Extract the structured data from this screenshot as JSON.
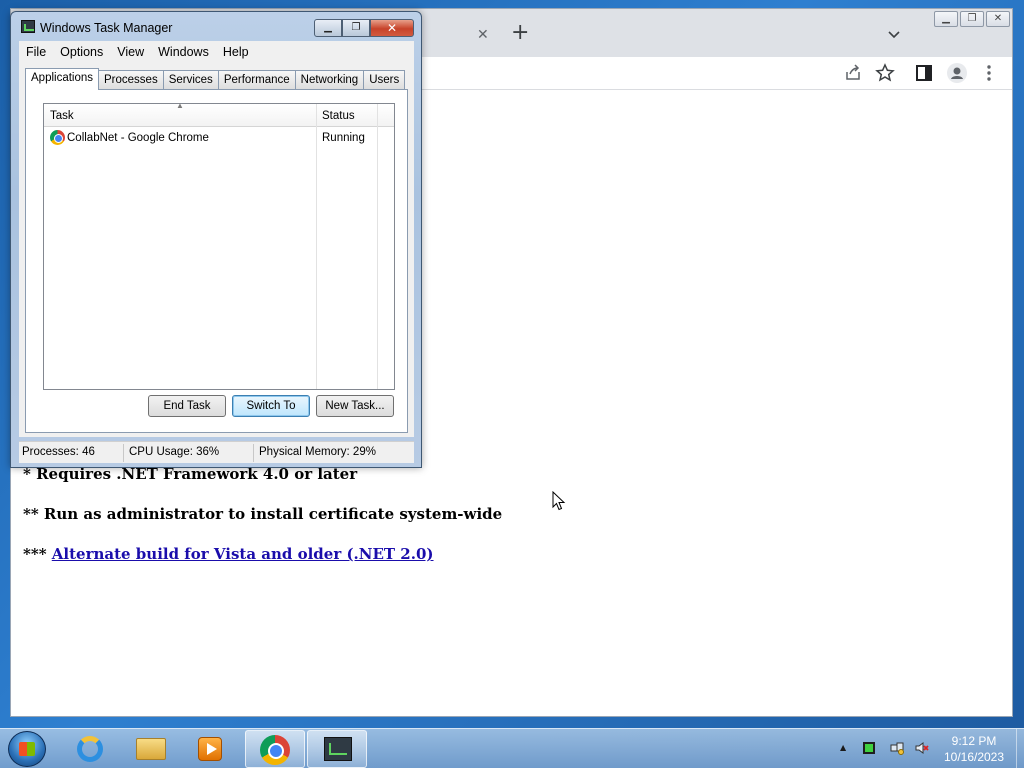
{
  "taskmanager": {
    "title": "Windows Task Manager",
    "menu": [
      "File",
      "Options",
      "View",
      "Windows",
      "Help"
    ],
    "tabs": [
      "Applications",
      "Processes",
      "Services",
      "Performance",
      "Networking",
      "Users"
    ],
    "active_tab": "Applications",
    "columns": {
      "task": "Task",
      "status": "Status"
    },
    "rows": [
      {
        "task": "CollabNet - Google Chrome",
        "status": "Running"
      }
    ],
    "buttons": {
      "end_task": "End Task",
      "switch_to": "Switch To",
      "new_task": "New Task..."
    },
    "statusbar": {
      "processes": "Processes: 46",
      "cpu": "CPU Usage: 36%",
      "memory": "Physical Memory: 29%"
    }
  },
  "browser": {
    "page": {
      "line1": "* Requires .NET Framework 4.0 or later",
      "line2": "** Run as administrator to install certificate system-wide",
      "line3_prefix": "*** ",
      "line3_link": "Alternate build for Vista and older (.NET 2.0)"
    }
  },
  "taskbar": {
    "clock_time": "9:12 PM",
    "clock_date": "10/16/2023",
    "pinned": [
      "internet-explorer",
      "windows-explorer",
      "media-player",
      "google-chrome",
      "task-manager"
    ]
  },
  "colors": {
    "link": "#1a0dab",
    "close_button": "#c7432a",
    "taskbar": "#6f9fd0"
  }
}
